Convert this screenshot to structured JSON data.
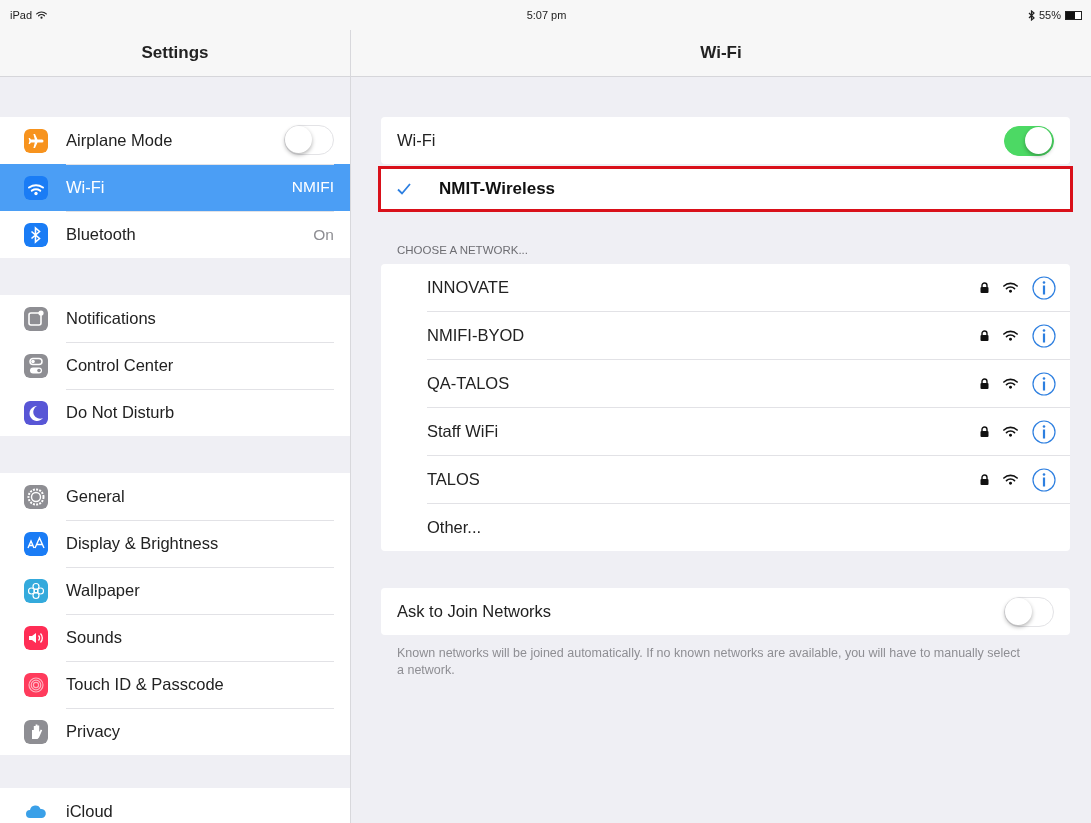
{
  "status_bar": {
    "device": "iPad",
    "time": "5:07 pm",
    "battery": "55%"
  },
  "sidebar": {
    "title": "Settings",
    "groups": [
      {
        "items": [
          {
            "label": "Airplane Mode",
            "kind": "toggle",
            "on": false,
            "selected": false,
            "color": "#f7931e"
          },
          {
            "label": "Wi-Fi",
            "kind": "value",
            "value": "NMIFI",
            "selected": true,
            "color": "#1a7cf5"
          },
          {
            "label": "Bluetooth",
            "kind": "value",
            "value": "On",
            "selected": false,
            "color": "#1a7cf5"
          }
        ]
      },
      {
        "items": [
          {
            "label": "Notifications",
            "kind": "plain",
            "selected": false,
            "color": "#8e8e93"
          },
          {
            "label": "Control Center",
            "kind": "plain",
            "selected": false,
            "color": "#8e8e93"
          },
          {
            "label": "Do Not Disturb",
            "kind": "plain",
            "selected": false,
            "color": "#5856d6"
          }
        ]
      },
      {
        "items": [
          {
            "label": "General",
            "kind": "plain",
            "selected": false,
            "color": "#8e8e93"
          },
          {
            "label": "Display & Brightness",
            "kind": "plain",
            "selected": false,
            "color": "#1a7cf5"
          },
          {
            "label": "Wallpaper",
            "kind": "plain",
            "selected": false,
            "color": "#34aadc"
          },
          {
            "label": "Sounds",
            "kind": "plain",
            "selected": false,
            "color": "#ff2d55"
          },
          {
            "label": "Touch ID & Passcode",
            "kind": "plain",
            "selected": false,
            "color": "#ff3b5c"
          },
          {
            "label": "Privacy",
            "kind": "plain",
            "selected": false,
            "color": "#8e8e93"
          }
        ]
      },
      {
        "items": [
          {
            "label": "iCloud",
            "kind": "plain",
            "selected": false
          }
        ]
      }
    ]
  },
  "detail": {
    "title": "Wi-Fi",
    "wifi": {
      "label": "Wi-Fi",
      "on": true
    },
    "connected": {
      "name": "NMIT-Wireless",
      "checked": true,
      "highlighted": true
    },
    "section_header": "CHOOSE A NETWORK...",
    "networks": [
      {
        "name": "INNOVATE",
        "kind": "secured"
      },
      {
        "name": "NMIFI-BYOD",
        "kind": "secured"
      },
      {
        "name": "QA-TALOS",
        "kind": "secured"
      },
      {
        "name": "Staff WiFi",
        "kind": "secured"
      },
      {
        "name": "TALOS",
        "kind": "secured"
      },
      {
        "name": "Other...",
        "kind": "other"
      }
    ],
    "ask_to_join": {
      "label": "Ask to Join Networks",
      "on": false
    },
    "footer": "Known networks will be joined automatically. If no known networks are available, you will have to manually select a network."
  }
}
